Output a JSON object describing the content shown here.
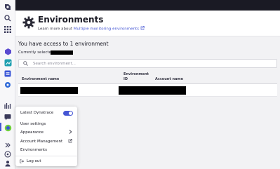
{
  "header": {
    "title": "Environments",
    "subtitle_prefix": "Learn more about",
    "subtitle_link": "Multiple monitoring environments"
  },
  "main": {
    "access_text": "You have access to 1 environment",
    "current_label": "Currently selected:",
    "search_placeholder": "Search environment...",
    "columns": {
      "name": "Environment name",
      "id_line1": "Environment",
      "id_line2": "ID",
      "account": "Account name"
    }
  },
  "menu": {
    "items": [
      "Latest Dynatrace",
      "User settings",
      "Appearance",
      "Account Management",
      "Environments",
      "Log out"
    ],
    "latest_dynatrace_enabled": true
  },
  "colors": {
    "accent": "#4556d4",
    "topbar": "#1a1a24",
    "background": "#f2f2f4"
  },
  "icons": [
    "dynatrace-logo-icon",
    "search-icon",
    "apps-grid-icon",
    "app-cube-icon",
    "chart-icon",
    "list-icon",
    "settings-icon",
    "hub-icon",
    "chat-icon",
    "help-icon",
    "user-icon",
    "environment-gear-icon",
    "external-link-icon",
    "chevron-right-icon",
    "logout-icon"
  ]
}
